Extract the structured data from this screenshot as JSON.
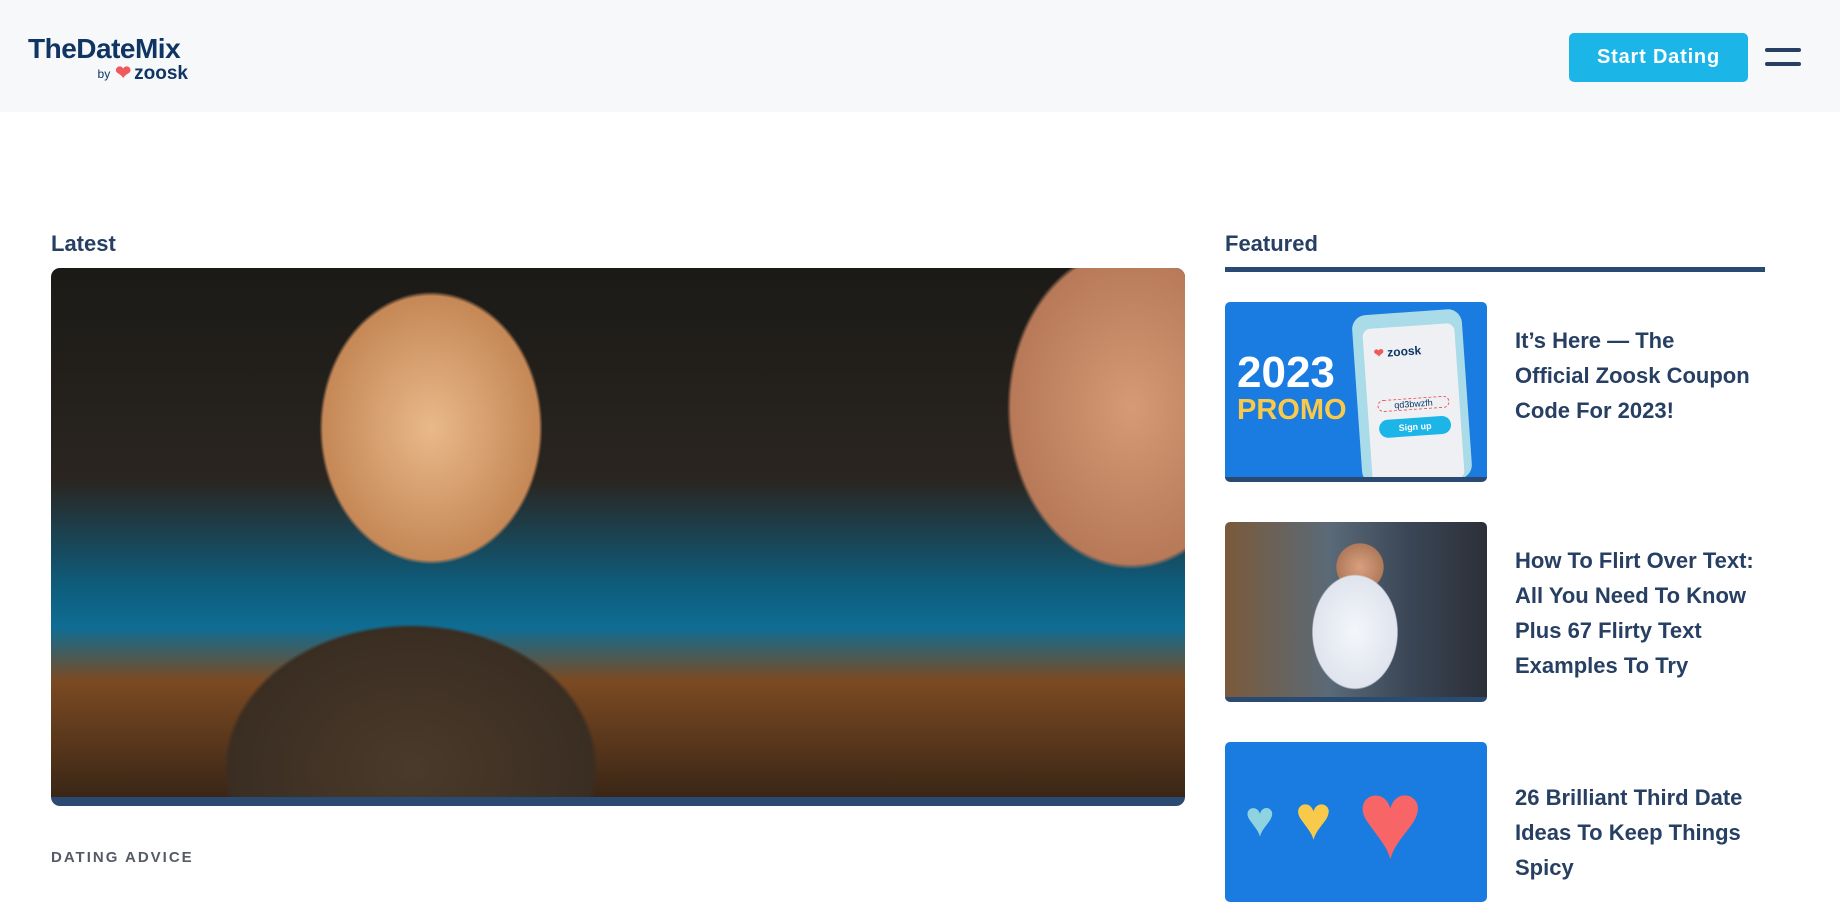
{
  "header": {
    "logo_text": "TheDateMix",
    "logo_by": "by",
    "logo_brand": "zoosk",
    "cta": "Start Dating",
    "menu_icon": "hamburger-icon"
  },
  "latest": {
    "heading": "Latest",
    "category": "DATING ADVICE"
  },
  "featured": {
    "heading": "Featured",
    "items": [
      {
        "title": "It’s Here — The Official Zoosk Coupon Code For 2023!",
        "image_year": "2023",
        "image_promo": "PROMO",
        "image_brand": "zoosk",
        "image_code": "qd3bwzfh",
        "image_signup": "Sign up"
      },
      {
        "title": "How To Flirt Over Text: All You Need To Know Plus 67 Flirty Text Examples To Try"
      },
      {
        "title": "26 Brilliant Third Date Ideas To Keep Things Spicy"
      }
    ]
  },
  "colors": {
    "navy": "#263f63",
    "cta": "#1cb5e8",
    "heart": "#f0595c"
  }
}
